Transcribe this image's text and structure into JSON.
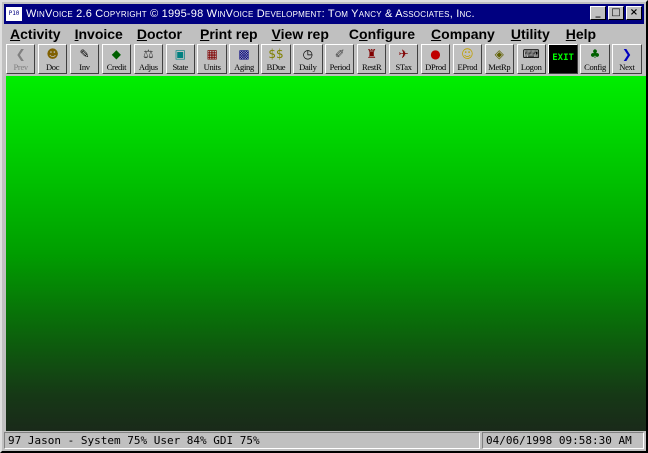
{
  "window": {
    "title": "WinVoice 2.6 Copyright © 1995-98 WinVoice Development: Tom Yancy & Associates, Inc.",
    "icon_text": "P10",
    "controls": {
      "minimize": "_",
      "maximize": "□",
      "close": "×"
    }
  },
  "menu": {
    "items": [
      {
        "pre": "",
        "ul": "A",
        "post": "ctivity"
      },
      {
        "pre": "",
        "ul": "I",
        "post": "nvoice"
      },
      {
        "pre": "",
        "ul": "D",
        "post": "octor"
      },
      {
        "pre": "",
        "ul": "P",
        "post": "rint rep"
      },
      {
        "pre": "",
        "ul": "V",
        "post": "iew rep"
      },
      {
        "pre": "C",
        "ul": "o",
        "post": "nfigure"
      },
      {
        "pre": "",
        "ul": "C",
        "post": "ompany"
      },
      {
        "pre": "",
        "ul": "U",
        "post": "tility"
      },
      {
        "pre": "",
        "ul": "H",
        "post": "elp"
      }
    ]
  },
  "toolbar": {
    "buttons": [
      {
        "label": "Prev",
        "icon": "chevron-left-icon",
        "glyph": "❮",
        "color": "#808080",
        "disabled": true
      },
      {
        "label": "Doc",
        "icon": "doctor-icon",
        "glyph": "☻",
        "color": "#806000"
      },
      {
        "label": "Inv",
        "icon": "invoice-icon",
        "glyph": "✎",
        "color": "#000000"
      },
      {
        "label": "Credit",
        "icon": "credit-icon",
        "glyph": "◆",
        "color": "#006000"
      },
      {
        "label": "Adjus",
        "icon": "scale-icon",
        "glyph": "⚖",
        "color": "#404040"
      },
      {
        "label": "State",
        "icon": "statement-icon",
        "glyph": "▣",
        "color": "#008080"
      },
      {
        "label": "Units",
        "icon": "units-icon",
        "glyph": "▦",
        "color": "#800000"
      },
      {
        "label": "Aging",
        "icon": "aging-chart-icon",
        "glyph": "▩",
        "color": "#000080"
      },
      {
        "label": "BDue",
        "icon": "dollar-icon",
        "glyph": "$$",
        "color": "#808000"
      },
      {
        "label": "Daily",
        "icon": "clock-icon",
        "glyph": "◷",
        "color": "#000000"
      },
      {
        "label": "Period",
        "icon": "period-icon",
        "glyph": "✐",
        "color": "#404040"
      },
      {
        "label": "RestR",
        "icon": "chair-icon",
        "glyph": "♜",
        "color": "#800000"
      },
      {
        "label": "STax",
        "icon": "tax-icon",
        "glyph": "✈",
        "color": "#800000"
      },
      {
        "label": "DProd",
        "icon": "doctor-production-icon",
        "glyph": "●",
        "color": "#c00000"
      },
      {
        "label": "EProd",
        "icon": "employee-production-icon",
        "glyph": "☺",
        "color": "#c0a000"
      },
      {
        "label": "MetRp",
        "icon": "metric-report-icon",
        "glyph": "◈",
        "color": "#606000"
      },
      {
        "label": "Logon",
        "icon": "logon-icon",
        "glyph": "⌨",
        "color": "#000000"
      },
      {
        "label": "EXIT",
        "icon": "exit-icon",
        "glyph": "",
        "color": "#00ff00"
      },
      {
        "label": "Config",
        "icon": "config-icon",
        "glyph": "♣",
        "color": "#006000"
      },
      {
        "label": "Next",
        "icon": "chevron-right-icon",
        "glyph": "❯",
        "color": "#0000c0"
      }
    ]
  },
  "status": {
    "left": "97 Jason - System 75% User 84% GDI 75%",
    "right": "04/06/1998 09:58:30 AM"
  },
  "colors": {
    "titlebar": "#000080",
    "gradient_top": "#00ee00",
    "gradient_bottom": "#1a2a1a"
  }
}
